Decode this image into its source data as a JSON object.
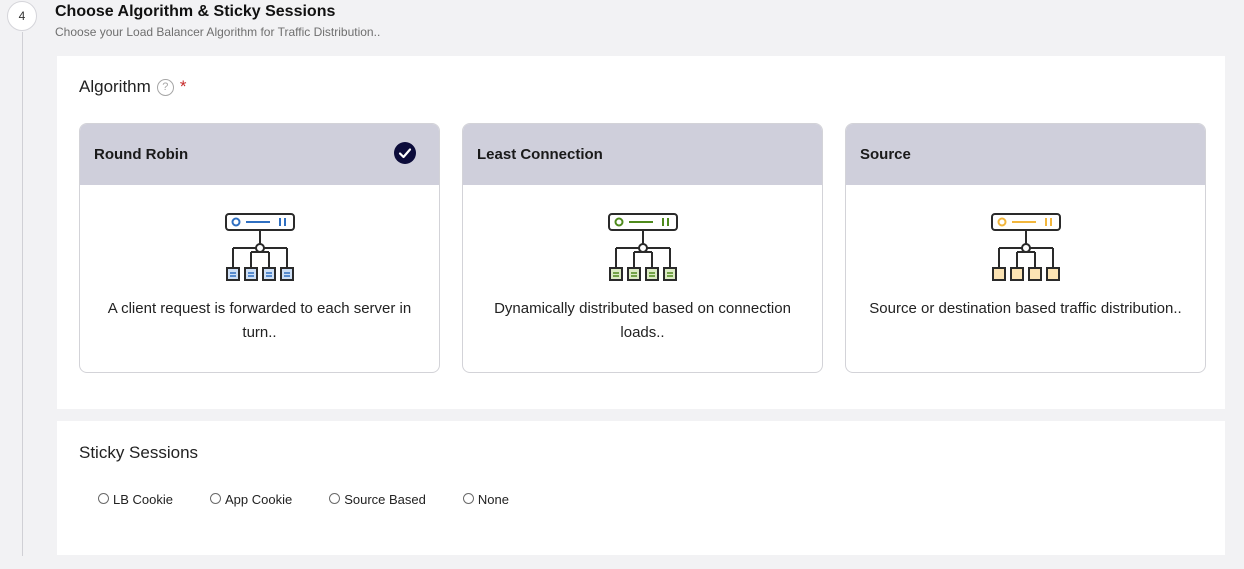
{
  "step": {
    "number": "4",
    "title": "Choose Algorithm & Sticky Sessions",
    "subtitle": "Choose your Load Balancer Algorithm for Traffic Distribution.."
  },
  "algorithm": {
    "title": "Algorithm",
    "help_icon": "?",
    "required_marker": "*",
    "selected": "Round Robin",
    "cards": [
      {
        "title": "Round Robin",
        "description": "A client request is forwarded to each server in turn..",
        "icon": "server-tree-icon",
        "accent_color": "#2f6fc1",
        "selected": true
      },
      {
        "title": "Least Connection",
        "description": "Dynamically distributed based on connection loads..",
        "icon": "server-tree-icon",
        "accent_color": "#4e8a1c",
        "selected": false
      },
      {
        "title": "Source",
        "description": "Source or destination based traffic distribution..",
        "icon": "server-tree-icon",
        "accent_color": "#f2b63c",
        "selected": false
      }
    ]
  },
  "sticky_sessions": {
    "title": "Sticky Sessions",
    "options": [
      "LB Cookie",
      "App Cookie",
      "Source Based",
      "None"
    ],
    "selected": null
  },
  "colors": {
    "card_header_bg": "#cfcfdb",
    "check_badge": "#0c0c3a",
    "required_star": "#c62828"
  }
}
